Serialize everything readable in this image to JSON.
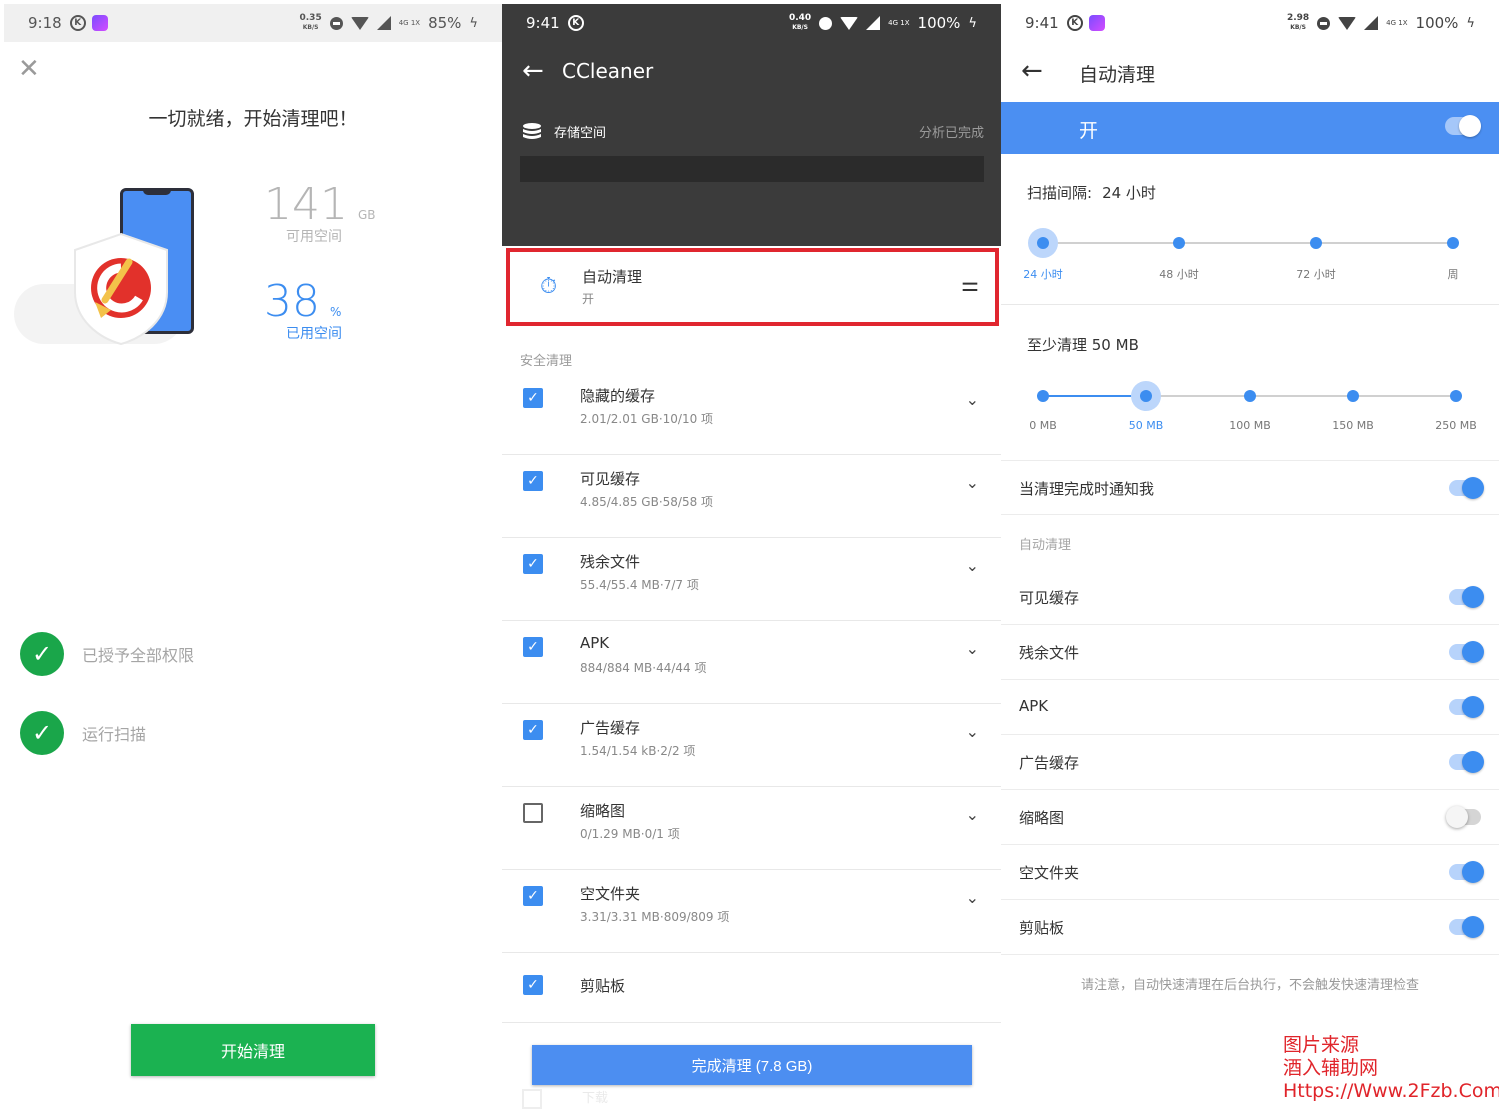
{
  "panel1": {
    "status": {
      "time": "9:18",
      "speed": "0.35",
      "speed_unit": "KB/S",
      "net": "4G 1X",
      "battery": "85%"
    },
    "title": "一切就绪，开始清理吧！",
    "free": {
      "value": "141",
      "unit": "GB",
      "label": "可用空间"
    },
    "used": {
      "value": "38",
      "unit": "%",
      "label": "已用空间"
    },
    "checks": [
      "已授予全部权限",
      "运行扫描"
    ],
    "start_button": "开始清理"
  },
  "panel2": {
    "status": {
      "time": "9:41",
      "speed": "0.40",
      "speed_unit": "KB/S",
      "net": "4G 1X",
      "battery": "100%"
    },
    "app_title": "CCleaner",
    "storage_label": "存储空间",
    "analysis_status": "分析已完成",
    "auto_clean": {
      "name": "自动清理",
      "state": "开"
    },
    "section": "安全清理",
    "items": [
      {
        "name": "隐藏的缓存",
        "meta": "2.01/2.01 GB·10/10 项",
        "checked": true
      },
      {
        "name": "可见缓存",
        "meta": "4.85/4.85 GB·58/58 项",
        "checked": true
      },
      {
        "name": "残余文件",
        "meta": "55.4/55.4 MB·7/7 项",
        "checked": true
      },
      {
        "name": "APK",
        "meta": "884/884 MB·44/44 项",
        "checked": true
      },
      {
        "name": "广告缓存",
        "meta": "1.54/1.54 kB·2/2 项",
        "checked": true
      },
      {
        "name": "缩略图",
        "meta": "0/1.29 MB·0/1 项",
        "checked": false
      },
      {
        "name": "空文件夹",
        "meta": "3.31/3.31 MB·809/809 项",
        "checked": true
      },
      {
        "name": "剪贴板",
        "meta": "",
        "checked": true
      }
    ],
    "finish_button": "完成清理 (7.8 GB)",
    "ghost_text": "下载"
  },
  "panel3": {
    "status": {
      "time": "9:41",
      "speed": "2.98",
      "speed_unit": "KB/S",
      "net": "4G 1X",
      "battery": "100%"
    },
    "page_title": "自动清理",
    "on_label": "开",
    "interval_label": "扫描间隔:",
    "interval_value": "24 小时",
    "interval_ticks": [
      "24 小时",
      "48 小时",
      "72 小时",
      "周"
    ],
    "interval_selected": 0,
    "min_label": "至少清理 50 MB",
    "min_ticks": [
      "0 MB",
      "50 MB",
      "100 MB",
      "150 MB",
      "250 MB"
    ],
    "min_selected": 1,
    "notify_label": "当清理完成时通知我",
    "notify_on": true,
    "subsection": "自动清理",
    "toggles": [
      {
        "name": "可见缓存",
        "on": true
      },
      {
        "name": "残余文件",
        "on": true
      },
      {
        "name": "APK",
        "on": true
      },
      {
        "name": "广告缓存",
        "on": true
      },
      {
        "name": "缩略图",
        "on": false
      },
      {
        "name": "空文件夹",
        "on": true
      },
      {
        "name": "剪贴板",
        "on": true
      }
    ],
    "note": "请注意，自动快速清理在后台执行，不会触发快速清理检查",
    "watermark": [
      "图片来源",
      "酒入辅助网",
      "Https://Www.2Fzb.Com"
    ]
  },
  "colors": {
    "accent_blue": "#3c8df0",
    "green": "#1bb251",
    "red_highlight": "#e0262f",
    "dark_header": "#3b3b3b"
  }
}
